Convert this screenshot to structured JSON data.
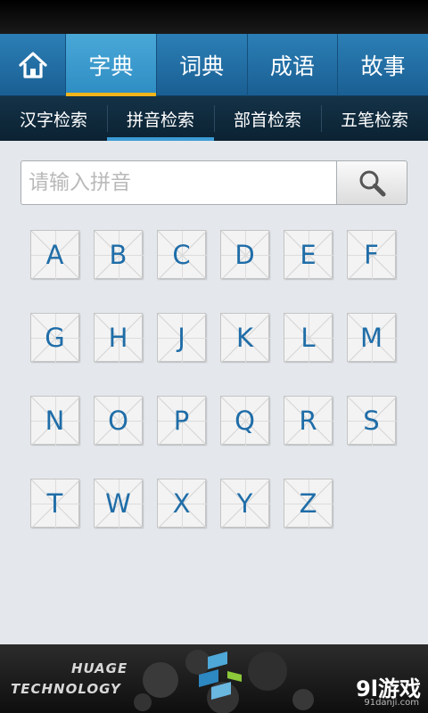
{
  "nav": {
    "home_icon": "home-icon",
    "tabs": [
      "字典",
      "词典",
      "成语",
      "故事"
    ],
    "active_tab": "字典"
  },
  "subnav": {
    "tabs": [
      "汉字检索",
      "拼音检索",
      "部首检索",
      "五笔检索"
    ],
    "active_tab": "拼音检索"
  },
  "search": {
    "placeholder": "请输入拼音",
    "value": "",
    "button_icon": "search-icon"
  },
  "letters": [
    "A",
    "B",
    "C",
    "D",
    "E",
    "F",
    "G",
    "H",
    "J",
    "K",
    "L",
    "M",
    "N",
    "O",
    "P",
    "Q",
    "R",
    "S",
    "T",
    "W",
    "X",
    "Y",
    "Z"
  ],
  "footer": {
    "brand_line1": "HUAGE",
    "brand_line2": "TECHNOLOGY",
    "watermark": "9l游戏",
    "watermark_sub": "91danji.com"
  },
  "colors": {
    "nav_blue": "#1f6ea5",
    "active_tab": "#3a9bd0",
    "accent_yellow": "#f2b51b",
    "letter_text": "#1f6da8"
  }
}
